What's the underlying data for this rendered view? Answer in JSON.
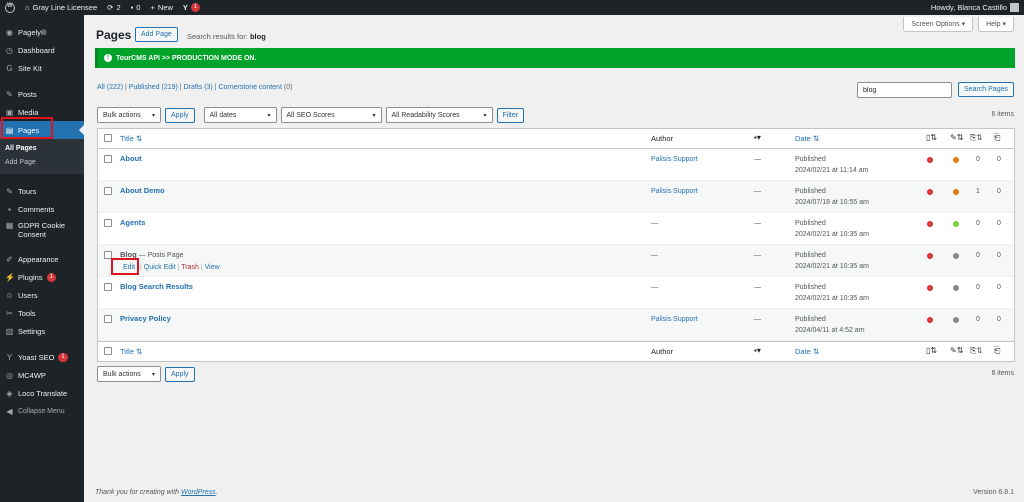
{
  "adminbar": {
    "site_name": "Gray Line Licensee",
    "updates_count": "2",
    "comments_count": "0",
    "new_label": "New",
    "yoast_badge": "1",
    "howdy": "Howdy, Blanca Castillo"
  },
  "sidebar": {
    "items": [
      {
        "label": "Pagely®",
        "icon": "pagely-icon"
      },
      {
        "label": "Dashboard",
        "icon": "dashboard-icon"
      },
      {
        "label": "Site Kit",
        "icon": "sitekit-icon"
      },
      {
        "label": "Posts",
        "icon": "pin-icon"
      },
      {
        "label": "Media",
        "icon": "media-icon"
      },
      {
        "label": "Pages",
        "icon": "pages-icon"
      },
      {
        "label": "Tours",
        "icon": "pin-icon"
      },
      {
        "label": "Comments",
        "icon": "comment-icon"
      },
      {
        "label": "GDPR Cookie Consent",
        "icon": "gdpr-icon"
      },
      {
        "label": "Appearance",
        "icon": "brush-icon"
      },
      {
        "label": "Plugins",
        "icon": "plugin-icon",
        "badge": "1"
      },
      {
        "label": "Users",
        "icon": "users-icon"
      },
      {
        "label": "Tools",
        "icon": "wrench-icon"
      },
      {
        "label": "Settings",
        "icon": "settings-icon"
      },
      {
        "label": "Yoast SEO",
        "icon": "yoast-icon",
        "badge": "1"
      },
      {
        "label": "MC4WP",
        "icon": "mc4wp-icon"
      },
      {
        "label": "Loco Translate",
        "icon": "translate-icon"
      }
    ],
    "submenu": {
      "all_pages": "All Pages",
      "add_page": "Add Page"
    },
    "collapse": "Collapse Menu"
  },
  "screen_options": "Screen Options",
  "help": "Help",
  "page_title": "Pages",
  "add_page_button": "Add Page",
  "search_results_prefix": "Search results for:",
  "search_term": "blog",
  "notice": "TourCMS API >> PRODUCTION MODE ON.",
  "views": {
    "all": "All",
    "all_count": "(222)",
    "published": "Published",
    "published_count": "(219)",
    "drafts": "Drafts",
    "drafts_count": "(3)",
    "cornerstone": "Cornerstone content",
    "cornerstone_count": "(0)"
  },
  "search": {
    "value": "blog",
    "button": "Search Pages"
  },
  "filters": {
    "bulk_actions": "Bulk actions",
    "apply": "Apply",
    "dates": "All dates",
    "seo": "All SEO Scores",
    "readability": "All Readability Scores",
    "filter": "Filter"
  },
  "items_count": "6 items",
  "columns": {
    "title": "Title",
    "author": "Author",
    "date": "Date"
  },
  "rows": [
    {
      "title": "About",
      "author": "Palisis Support",
      "comments": "—",
      "status": "Published",
      "date": "2024/02/21 at 11:14 am",
      "seo": "#d63638",
      "read": "#e57a10",
      "links": "0",
      "linked": "0"
    },
    {
      "title": "About Demo",
      "author": "Palisis Support",
      "comments": "—",
      "status": "Published",
      "date": "2024/07/18 at 10:55 am",
      "seo": "#d63638",
      "read": "#e57a10",
      "links": "1",
      "linked": "0"
    },
    {
      "title": "Agents",
      "author": "—",
      "comments": "—",
      "status": "Published",
      "date": "2024/02/21 at 10:35 am",
      "seo": "#d63638",
      "read": "#7ad03a",
      "links": "0",
      "linked": "0"
    },
    {
      "title": "Blog",
      "state": "— Posts Page",
      "author": "—",
      "comments": "—",
      "status": "Published",
      "date": "2024/02/21 at 10:35 am",
      "seo": "#d63638",
      "read": "#888888",
      "links": "0",
      "linked": "0"
    },
    {
      "title": "Blog Search Results",
      "author": "—",
      "comments": "—",
      "status": "Published",
      "date": "2024/02/21 at 10:35 am",
      "seo": "#d63638",
      "read": "#888888",
      "links": "0",
      "linked": "0"
    },
    {
      "title": "Privacy Policy",
      "author": "Palisis Support",
      "comments": "—",
      "status": "Published",
      "date": "2024/04/11 at 4:52 am",
      "seo": "#d63638",
      "read": "#888888",
      "links": "0",
      "linked": "0"
    }
  ],
  "row_actions": {
    "edit": "Edit",
    "quick_edit": "Quick Edit",
    "trash": "Trash",
    "view": "View"
  },
  "footer": {
    "thanks": "Thank you for creating with",
    "wordpress": "WordPress",
    "version": "Version 6.8.1"
  }
}
